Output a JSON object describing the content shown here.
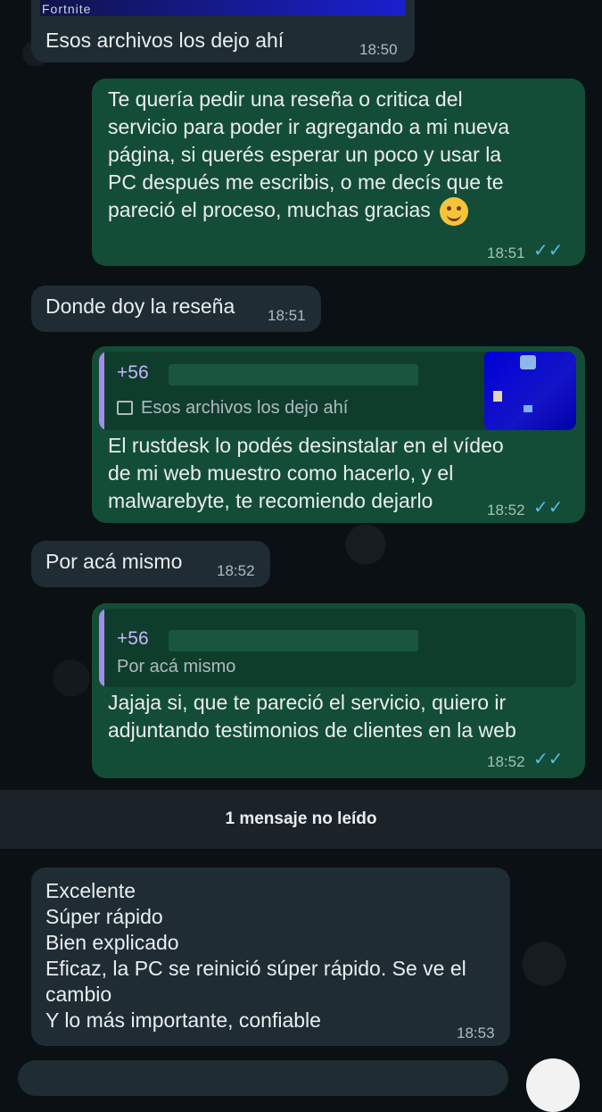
{
  "top_partial_label": "Fortnite",
  "messages": [
    {
      "id": "m1",
      "dir": "in",
      "text": "Esos archivos los dejo ahí",
      "time": "18:50"
    },
    {
      "id": "m2",
      "dir": "out",
      "lines": [
        "Te quería  pedir una reseña o critica del",
        "servicio para poder ir agregando a mi nueva",
        "página, si querés esperar un poco y usar la",
        "PC después me escribis, o me decís que te",
        "pareció el proceso, muchas gracias"
      ],
      "time": "18:51",
      "status": "read"
    },
    {
      "id": "m3",
      "dir": "in",
      "text": "Donde doy la reseña",
      "time": "18:51"
    },
    {
      "id": "m4",
      "dir": "out",
      "quote": {
        "author": "+56",
        "text": "Esos archivos los dejo ahí"
      },
      "lines": [
        "El rustdesk lo podés desinstalar en el vídeo",
        "de mi web muestro como hacerlo, y el",
        "malwarebyte, te recomiendo dejarlo"
      ],
      "time": "18:52",
      "status": "read"
    },
    {
      "id": "m5",
      "dir": "in",
      "text": "Por acá mismo",
      "time": "18:52"
    },
    {
      "id": "m6",
      "dir": "out",
      "quote": {
        "author": "+56",
        "text": "Por acá mismo"
      },
      "lines": [
        "Jajaja si, que te pareció el servicio, quiero ir",
        "adjuntando testimonios de clientes en la web"
      ],
      "time": "18:52",
      "status": "read"
    },
    {
      "id": "m7",
      "dir": "in",
      "lines": [
        "Excelente",
        "Súper rápido",
        "Bien explicado",
        "Eficaz, la PC se reinició súper rápido. Se ve el",
        "cambio",
        "Y lo más importante, confiable"
      ],
      "time": "18:53"
    }
  ],
  "unread_divider": "1 mensaje no leído",
  "colors": {
    "incoming": "#1f2c33",
    "outgoing": "#144d37",
    "read_ticks": "#53bdeb",
    "background": "#0b1014"
  }
}
